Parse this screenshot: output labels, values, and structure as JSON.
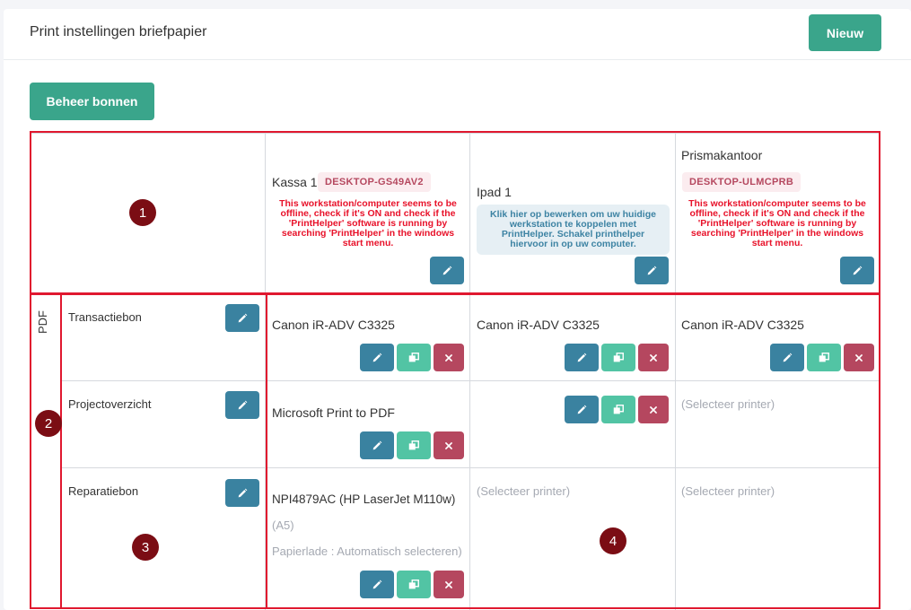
{
  "header": {
    "title": "Print instellingen briefpapier",
    "new_button": "Nieuw"
  },
  "toolbar": {
    "manage_button": "Beheer bonnen"
  },
  "workstations": [
    {
      "name": "Kassa 1",
      "host": "DESKTOP-GS49AV2",
      "status": "This workstation/computer seems to be offline, check if it's ON and check if the 'PrintHelper' software is running by searching 'PrintHelper' in the windows start menu."
    },
    {
      "name": "Ipad 1",
      "host": "",
      "status": "Klik hier op bewerken om uw huidige werkstation te koppelen met PrintHelper. Schakel printhelper hiervoor in op uw computer."
    },
    {
      "name": "Prismakantoor",
      "host": "DESKTOP-ULMCPRB",
      "status": "This workstation/computer seems to be offline, check if it's ON and check if the 'PrintHelper' software is running by searching 'PrintHelper' in the windows start menu."
    }
  ],
  "group": {
    "label": "PDF"
  },
  "documents": [
    {
      "name": "Transactiebon",
      "cells": [
        {
          "printer": "Canon iR-ADV C3325"
        },
        {
          "printer": "Canon iR-ADV C3325"
        },
        {
          "printer": "Canon iR-ADV C3325"
        }
      ]
    },
    {
      "name": "Projectoverzicht",
      "cells": [
        {
          "printer": "Microsoft Print to PDF"
        },
        {
          "printer": ""
        },
        {
          "printer": "(Selecteer printer)"
        }
      ]
    },
    {
      "name": "Reparatiebon",
      "cells": [
        {
          "printer": "NPI4879AC (HP LaserJet M110w)",
          "paper": "(A5)",
          "tray": "Papierlade : Automatisch selecteren)"
        },
        {
          "printer": "(Selecteer printer)"
        },
        {
          "printer": "(Selecteer printer)"
        }
      ]
    }
  ],
  "annotations": {
    "m1": "1",
    "m2": "2",
    "m3": "3",
    "m4": "4"
  },
  "colors": {
    "primary": "#3aa58b",
    "edit": "#3a82a0",
    "copy": "#52c4a4",
    "delete": "#b5475f",
    "warning": "#e8122a",
    "annotation": "#e0182f"
  },
  "icons": {
    "edit": "pencil-icon",
    "copy": "copy-icon",
    "delete": "close-icon"
  }
}
